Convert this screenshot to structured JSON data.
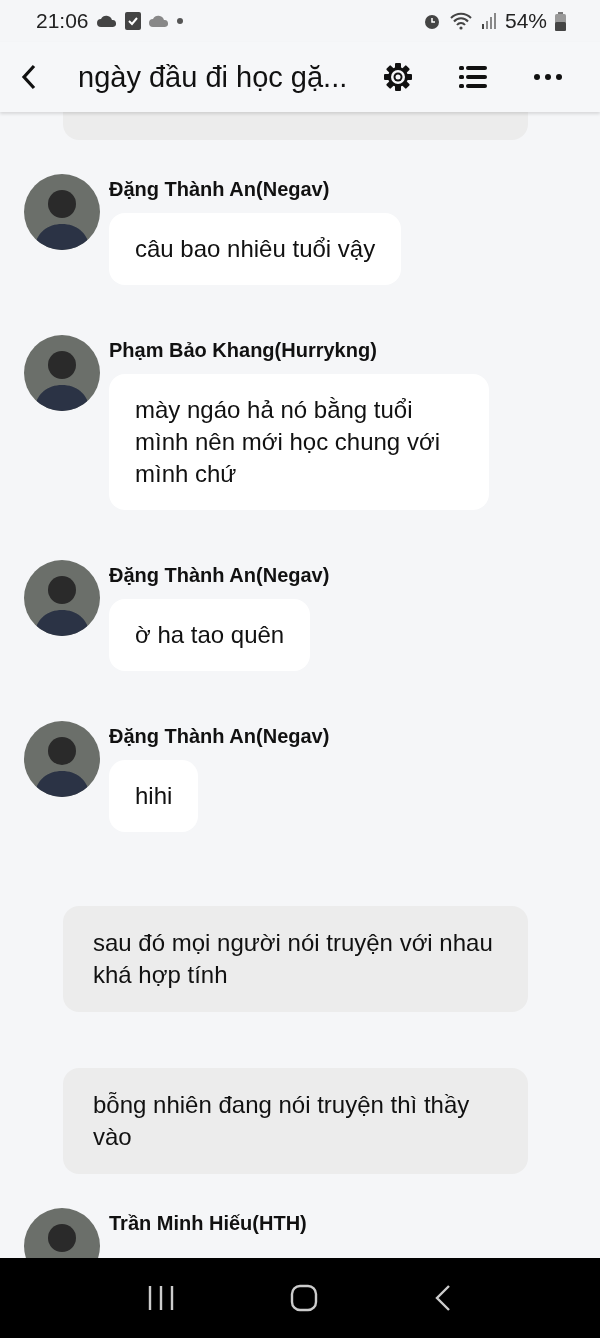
{
  "status_bar": {
    "time": "21:06",
    "battery": "54%"
  },
  "header": {
    "title": "ngày đầu đi học gặ..."
  },
  "messages": [
    {
      "kind": "narration"
    },
    {
      "kind": "message",
      "sender": "Đặng Thành An(Negav)",
      "text": "câu bao nhiêu tuổi vậy"
    },
    {
      "kind": "message",
      "sender": "Phạm Bảo Khang(Hurrykng)",
      "text": "mày ngáo hả nó bằng tuổi mình nên mới học chung với mình chứ"
    },
    {
      "kind": "message",
      "sender": "Đặng Thành An(Negav)",
      "text": "ờ ha tao quên"
    },
    {
      "kind": "message",
      "sender": "Đặng Thành An(Negav)",
      "text": "hihi"
    },
    {
      "kind": "narration",
      "text": "sau đó mọi người nói truyện với nhau khá hợp tính"
    },
    {
      "kind": "narration",
      "text": "bỗng nhiên đang nói truyện thì thầy vào"
    },
    {
      "kind": "message",
      "sender": "Trần Minh Hiếu(HTH)"
    }
  ]
}
